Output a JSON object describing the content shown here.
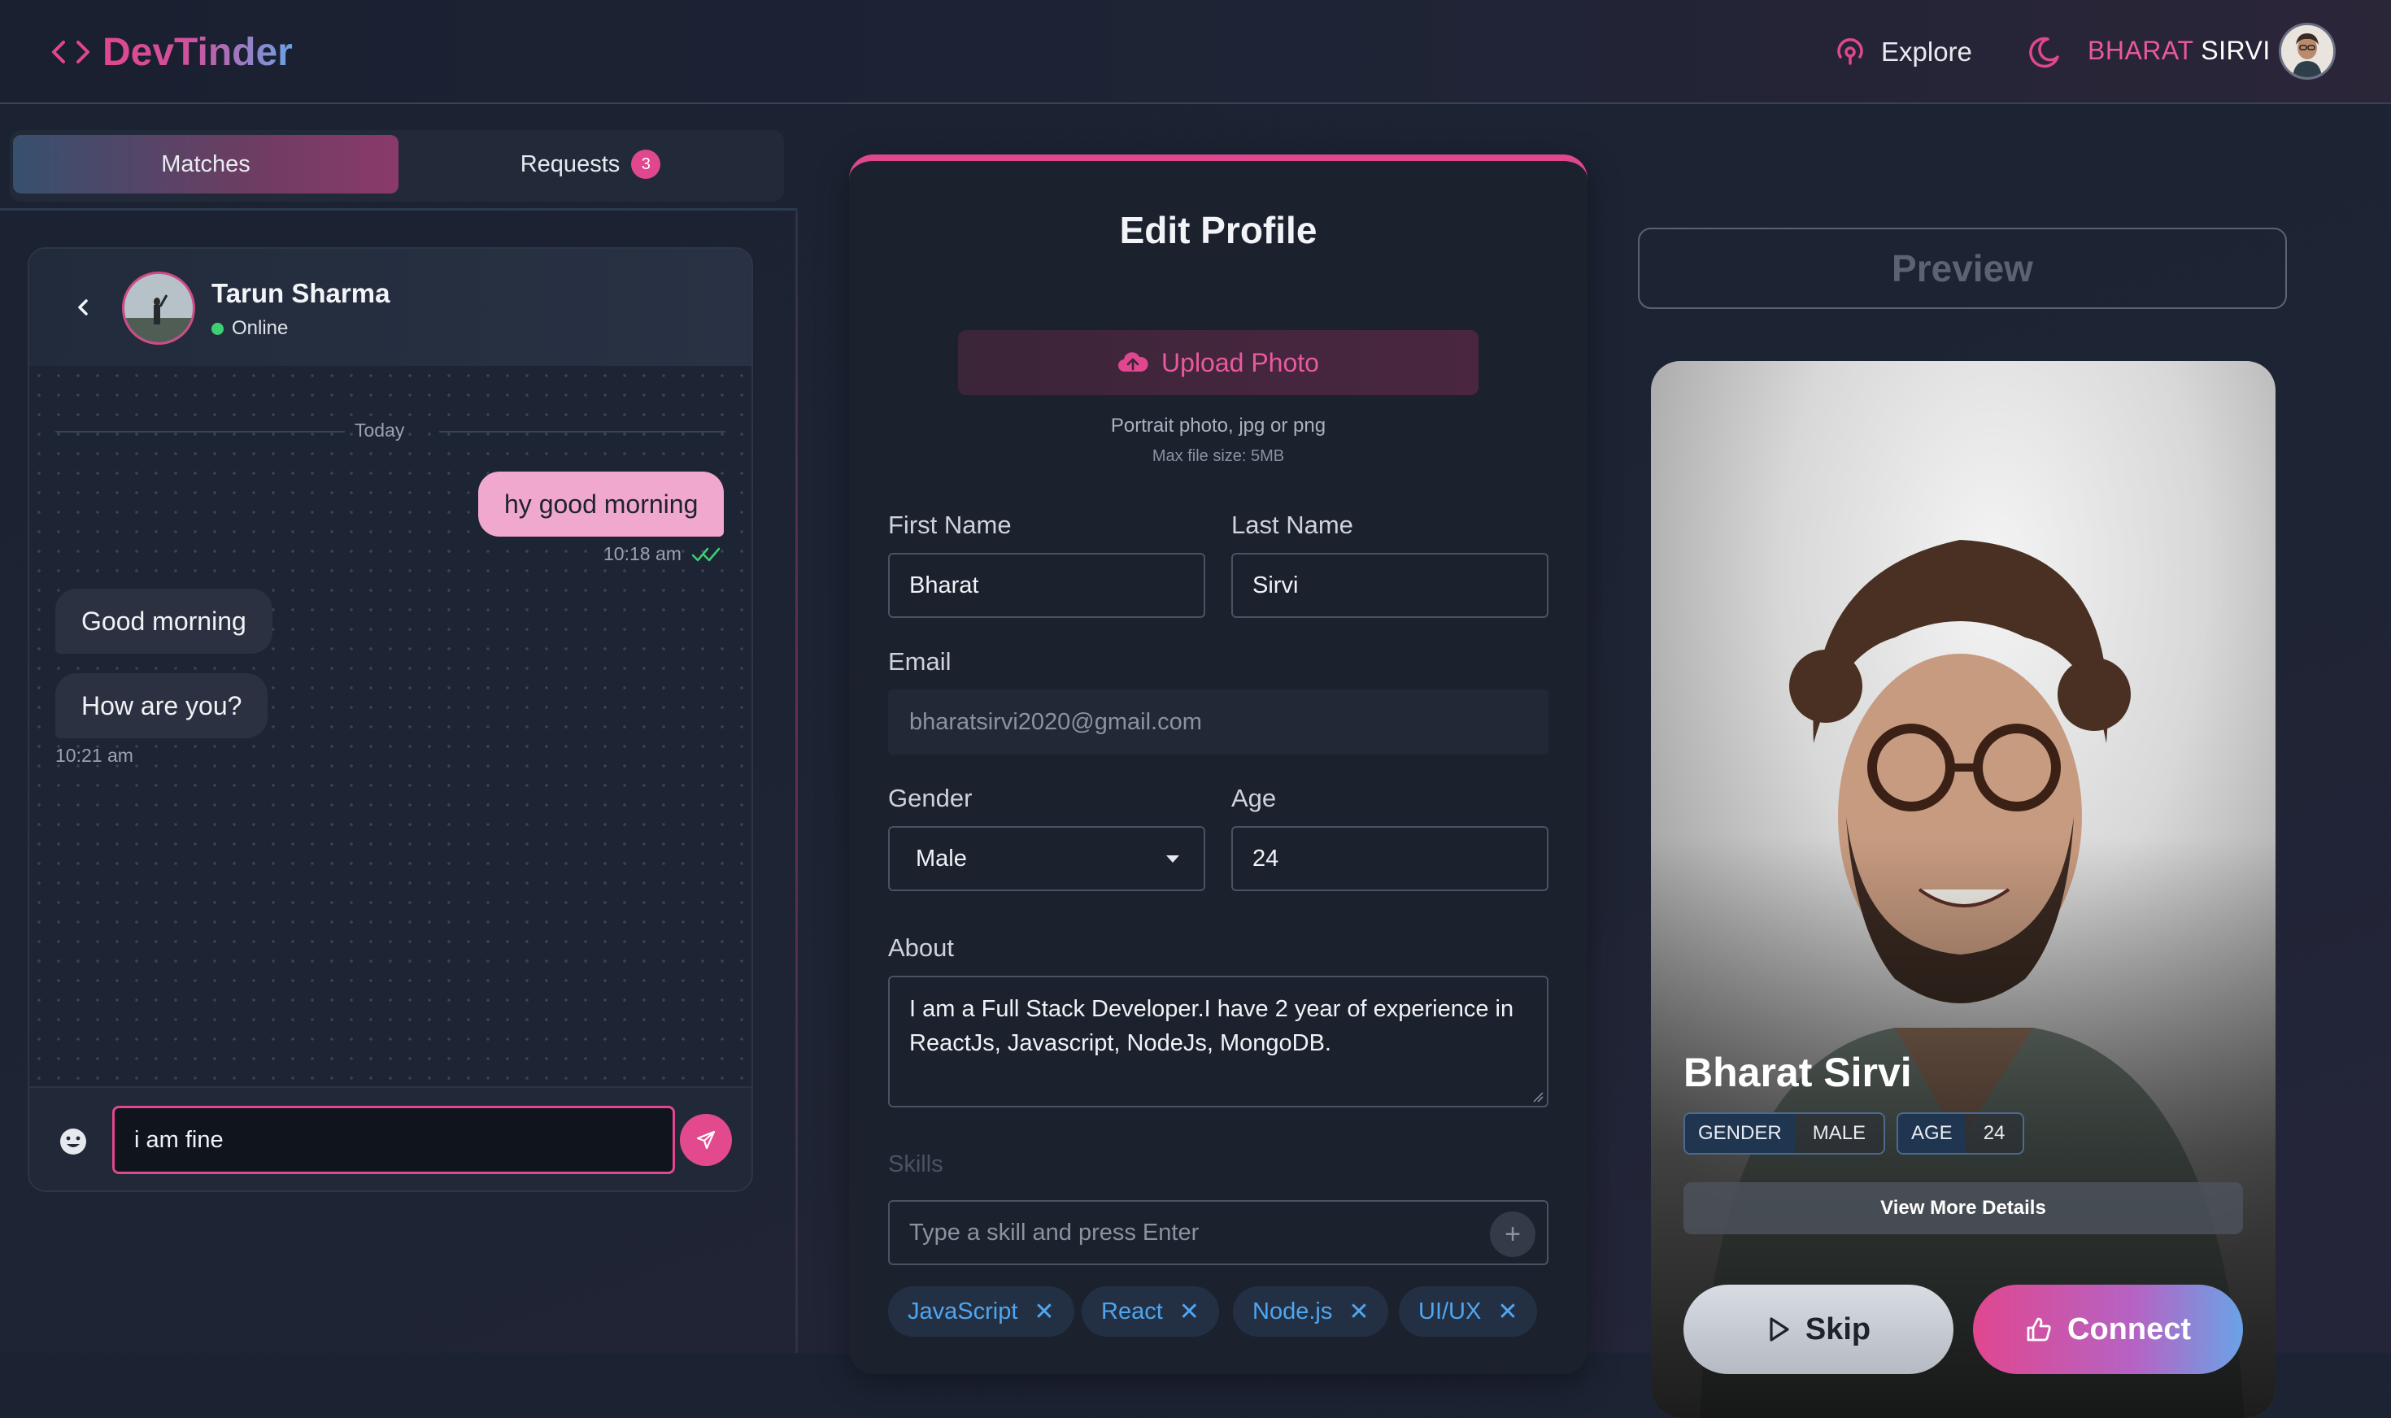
{
  "nav": {
    "brand": "DevTinder",
    "explore_label": "Explore",
    "user_first": "BHARAT",
    "user_last": "SIRVI"
  },
  "tabs": {
    "matches_label": "Matches",
    "requests_label": "Requests",
    "requests_count": "3"
  },
  "chat": {
    "contact_name": "Tarun Sharma",
    "contact_status": "Online",
    "day_label": "Today",
    "messages": [
      {
        "direction": "out",
        "text": "hy good morning",
        "time": "10:18 am"
      },
      {
        "direction": "in",
        "text": "Good morning"
      },
      {
        "direction": "in",
        "text": "How are you?",
        "time": "10:21 am"
      }
    ],
    "input_value": "i am fine"
  },
  "profile": {
    "title": "Edit Profile",
    "upload_label": "Upload Photo",
    "upload_hint": "Portrait photo, jpg or png",
    "upload_max": "Max file size: 5MB",
    "first_name_label": "First Name",
    "first_name": "Bharat",
    "last_name_label": "Last Name",
    "last_name": "Sirvi",
    "email_label": "Email",
    "email": "bharatsirvi2020@gmail.com",
    "gender_label": "Gender",
    "gender": "Male",
    "age_label": "Age",
    "age": "24",
    "about_label": "About",
    "about": "I am a Full Stack Developer.I have 2 year of experience in ReactJs, Javascript, NodeJs, MongoDB.",
    "skills_label": "Skills",
    "skill_placeholder": "Type a skill and press Enter",
    "skills": [
      "JavaScript",
      "React",
      "Node.js",
      "UI/UX"
    ]
  },
  "preview": {
    "button_label": "Preview",
    "name": "Bharat Sirvi",
    "gender_key": "GENDER",
    "gender_value": "MALE",
    "age_key": "AGE",
    "age_value": "24",
    "more_label": "View More Details",
    "skip_label": "Skip",
    "connect_label": "Connect"
  },
  "colors": {
    "accent_pink": "#e0478f",
    "accent_blue": "#6aa3e6",
    "bubble_out": "#f0a8cf",
    "online": "#3ecf73",
    "skill_chip": "#4fa6ef"
  },
  "icons": [
    "code-icon",
    "explore-icon",
    "moon-icon",
    "chevron-left-icon",
    "check-double-icon",
    "emoji-icon",
    "send-icon",
    "cloud-upload-icon",
    "caret-down-icon",
    "plus-icon",
    "close-icon",
    "play-icon",
    "thumbs-up-icon"
  ]
}
